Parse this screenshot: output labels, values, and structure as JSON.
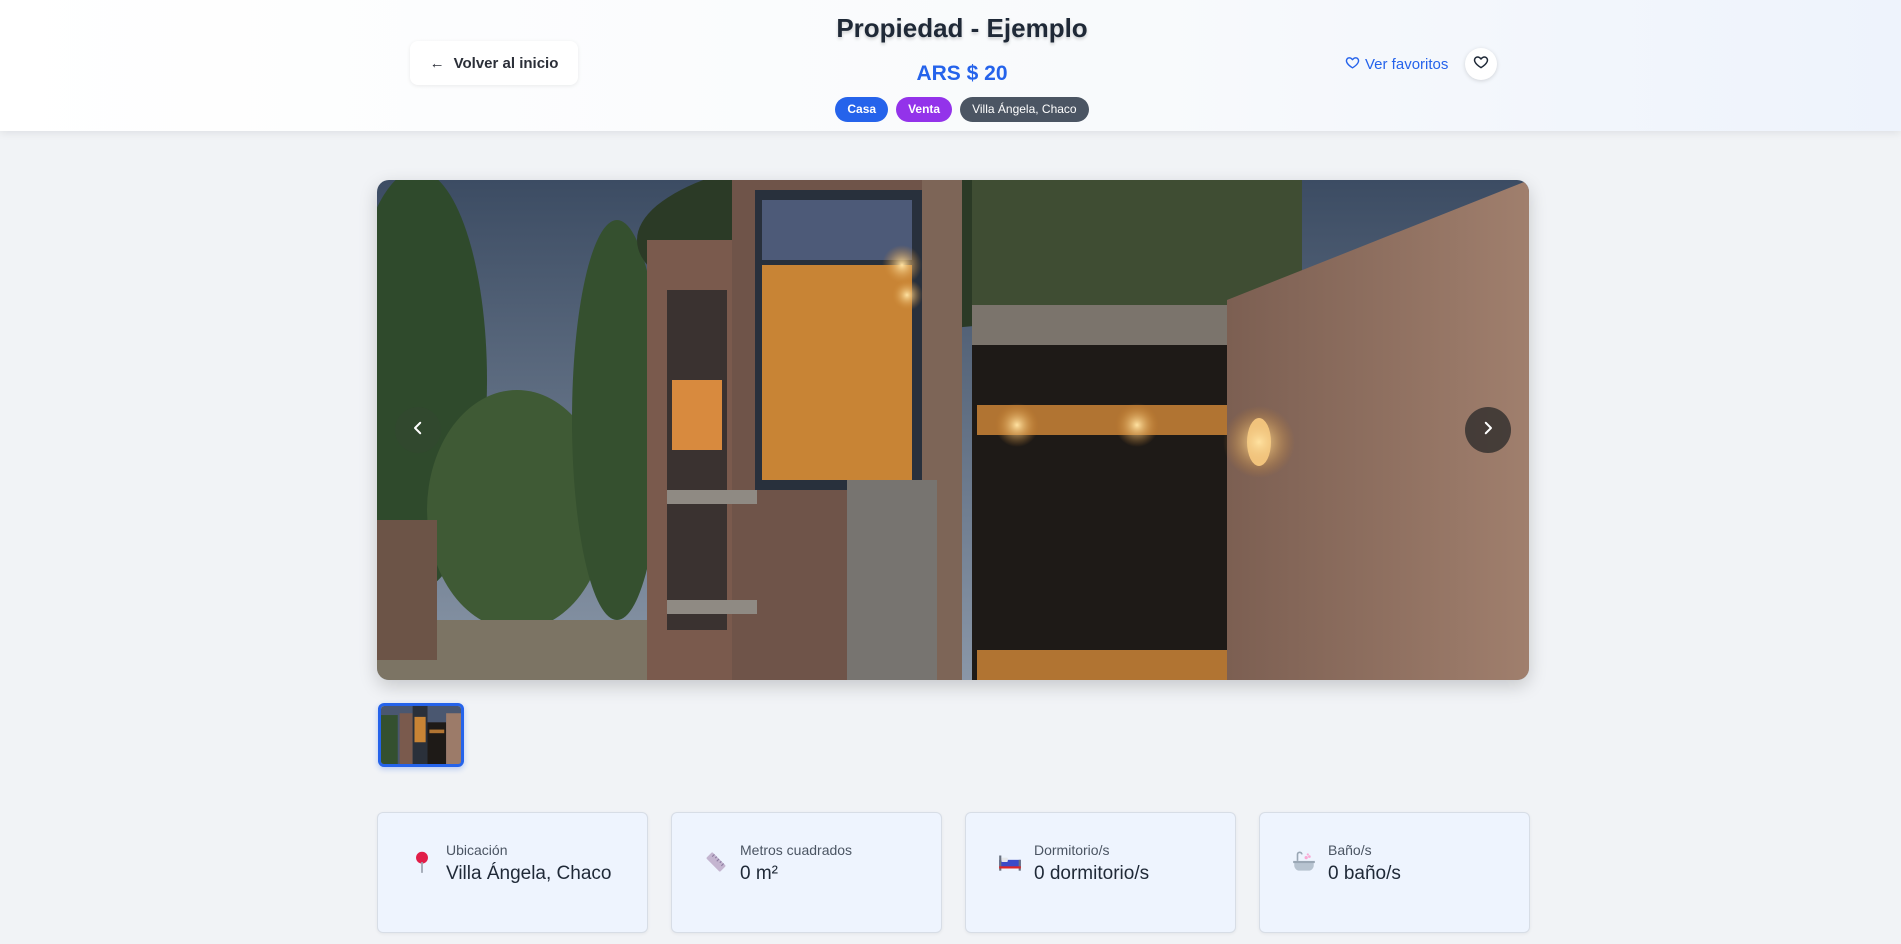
{
  "header": {
    "back_label": "Volver al inicio",
    "title": "Propiedad - Ejemplo",
    "price": "ARS $ 20",
    "badges": [
      "Casa",
      "Venta",
      "Villa Ángela, Chaco"
    ],
    "favorites_label": "Ver favoritos"
  },
  "gallery": {
    "prev_icon": "chevron-left-icon",
    "next_icon": "chevron-right-icon"
  },
  "info": {
    "location": {
      "label": "Ubicación",
      "value": "Villa Ángela, Chaco",
      "icon": "pin-icon"
    },
    "area": {
      "label": "Metros cuadrados",
      "value": "0 m²",
      "icon": "ruler-icon"
    },
    "bedrooms": {
      "label": "Dormitorio/s",
      "value": "0 dormitorio/s",
      "icon": "bed-icon"
    },
    "bathrooms": {
      "label": "Baño/s",
      "value": "0 baño/s",
      "icon": "bathtub-icon"
    }
  },
  "colors": {
    "accent": "#2563eb",
    "badge_casa": "#2563eb",
    "badge_venta": "#9333ea",
    "badge_location": "#4b5563"
  }
}
